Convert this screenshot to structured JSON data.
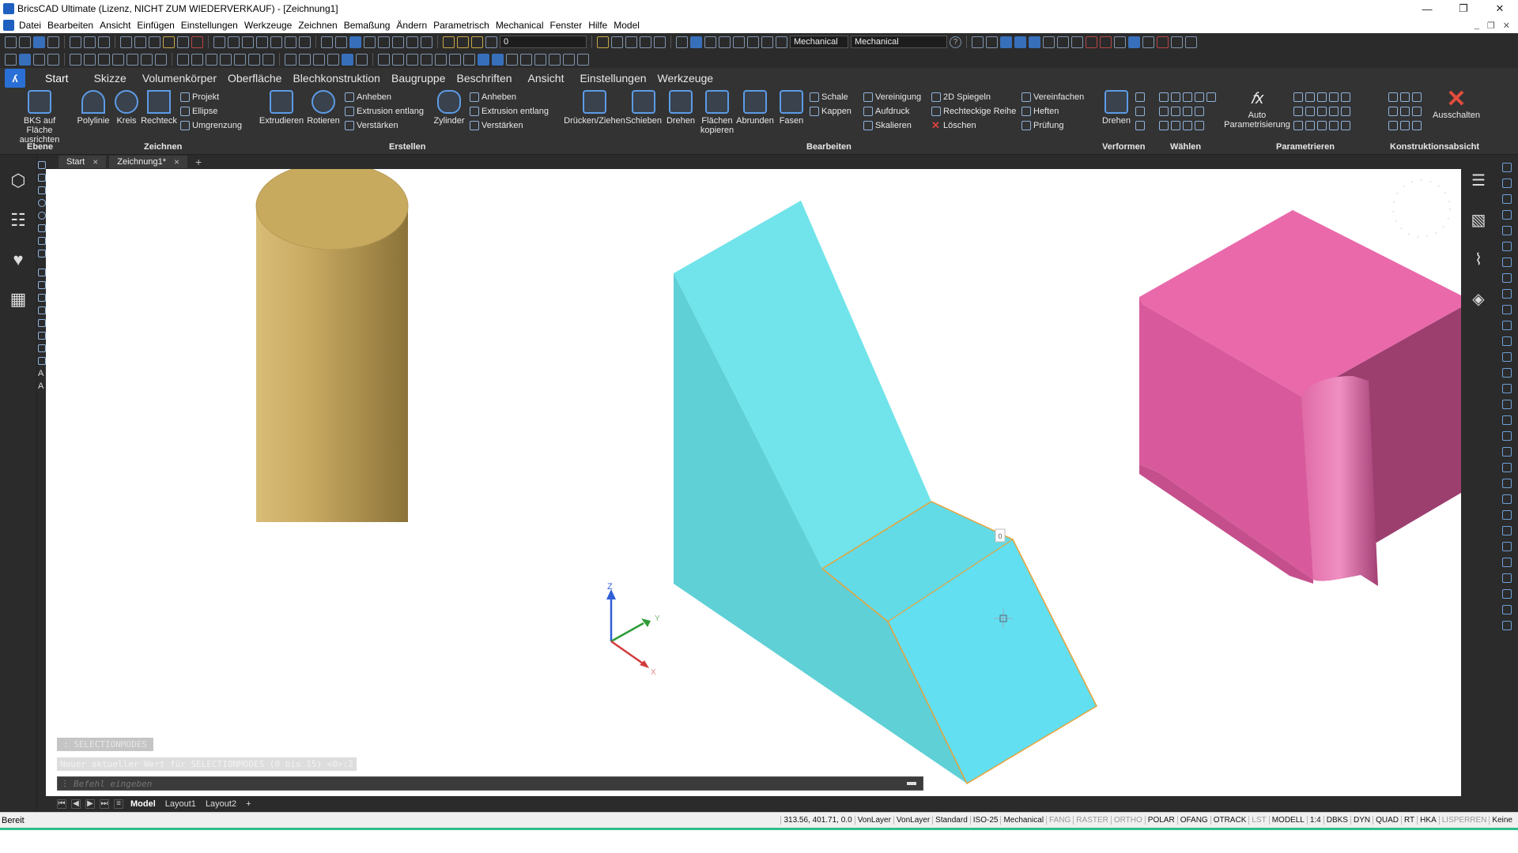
{
  "window": {
    "title": "BricsCAD Ultimate (Lizenz, NICHT ZUM WIEDERVERKAUF) - [Zeichnung1]",
    "min": "—",
    "max": "❐",
    "close": "✕"
  },
  "menu": [
    "Datei",
    "Bearbeiten",
    "Ansicht",
    "Einfügen",
    "Einstellungen",
    "Werkzeuge",
    "Zeichnen",
    "Bemaßung",
    "Ändern",
    "Parametrisch",
    "Mechanical",
    "Fenster",
    "Hilfe",
    "Model"
  ],
  "toolbar": {
    "layer_value": "0",
    "workspace_value": "Mechanical",
    "workspace_value2": "Mechanical",
    "help": "?"
  },
  "ribbon_tabs": [
    "Start",
    "Skizze",
    "Volumenkörper",
    "Oberfläche",
    "Blechkonstruktion",
    "Baugruppe",
    "Beschriften",
    "Ansicht",
    "Einstellungen",
    "Werkzeuge"
  ],
  "ribbon": {
    "bks": "BKS auf Fläche ausrichten",
    "polylinie": "Polylinie",
    "kreis": "Kreis",
    "rechteck": "Rechteck",
    "projekt": "Projekt",
    "ellipse": "Ellipse",
    "umgrenzung": "Umgrenzung",
    "extrudieren": "Extrudieren",
    "rotieren": "Rotieren",
    "anheben1": "Anheben",
    "extrusion1": "Extrusion entlang",
    "verstaerken1": "Verstärken",
    "zylinder": "Zylinder",
    "anheben2": "Anheben",
    "extrusion2": "Extrusion entlang",
    "verstaerken2": "Verstärken",
    "druecken": "Drücken/Ziehen",
    "schieben": "Schieben",
    "drehen1": "Drehen",
    "flaechen": "Flächen kopieren",
    "abrunden": "Abrunden",
    "fasen": "Fasen",
    "schale": "Schale",
    "kappen": "Kappen",
    "vereinigung": "Vereinigung",
    "aufdruck": "Aufdruck",
    "skalieren": "Skalieren",
    "spiegeln": "2D Spiegeln",
    "reihe": "Rechteckige Reihe",
    "loeschen": "Löschen",
    "vereinfachen": "Vereinfachen",
    "heften": "Heften",
    "pruefung": "Prüfung",
    "drehen2": "Drehen",
    "auto": "Auto Parametrisierung",
    "ausschalten": "Ausschalten",
    "groups": [
      "Ebene",
      "Zeichnen",
      "Erstellen",
      "Bearbeiten",
      "Verformen",
      "Wählen",
      "Parametrieren",
      "Konstruktionsabsicht"
    ]
  },
  "doc_tabs": [
    "Start",
    "Zeichnung1*"
  ],
  "viewport": {
    "axis_labels": {
      "z": "Z",
      "y": "Y",
      "x": "X"
    },
    "grip_label": "0",
    "colors": {
      "cyan": "#6fe3ea",
      "pink": "#e36aa8",
      "gold": "#bfa25a",
      "edge": "#e8a23a"
    }
  },
  "command": {
    "history1": ": SELECTIONMODES",
    "history2": "Neuer aktueller Wert für  SELECTIONMODES (0 bis 15) <0>:2",
    "placeholder": "Befehl eingeben"
  },
  "layout_tabs": [
    "Model",
    "Layout1",
    "Layout2"
  ],
  "status": {
    "ready": "Bereit",
    "fields": [
      {
        "t": "313.56, 401.71, 0.0",
        "on": true
      },
      {
        "t": "VonLayer",
        "on": true
      },
      {
        "t": "VonLayer",
        "on": true
      },
      {
        "t": "Standard",
        "on": true
      },
      {
        "t": "ISO-25",
        "on": true
      },
      {
        "t": "Mechanical",
        "on": true
      },
      {
        "t": "FANG",
        "on": false
      },
      {
        "t": "RASTER",
        "on": false
      },
      {
        "t": "ORTHO",
        "on": false
      },
      {
        "t": "POLAR",
        "on": true
      },
      {
        "t": "OFANG",
        "on": true
      },
      {
        "t": "OTRACK",
        "on": true
      },
      {
        "t": "LST",
        "on": false
      },
      {
        "t": "MODELL",
        "on": true
      },
      {
        "t": "1:4",
        "on": true
      },
      {
        "t": "DBKS",
        "on": true
      },
      {
        "t": "DYN",
        "on": true
      },
      {
        "t": "QUAD",
        "on": true
      },
      {
        "t": "RT",
        "on": true
      },
      {
        "t": "HKA",
        "on": true
      },
      {
        "t": "LISPERREN",
        "on": false
      },
      {
        "t": "Keine",
        "on": true
      }
    ]
  }
}
